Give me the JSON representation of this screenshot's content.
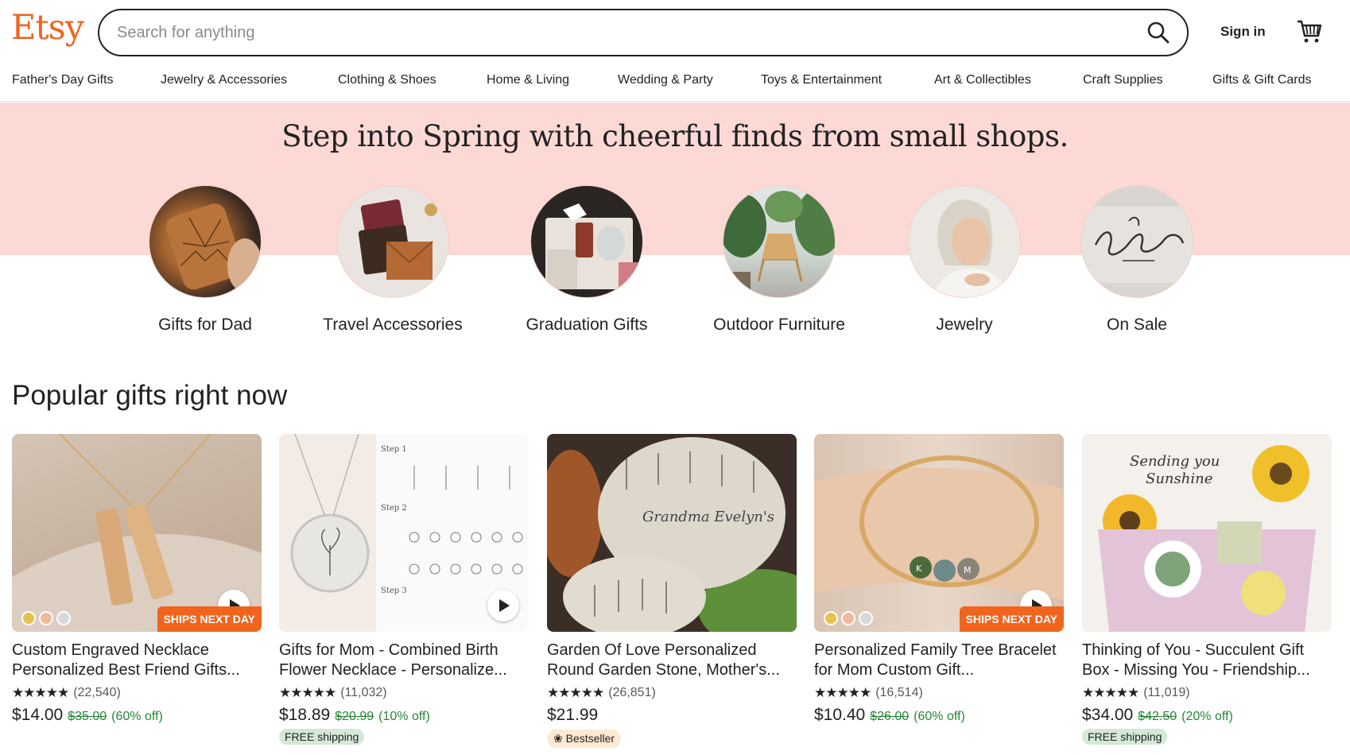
{
  "header": {
    "logo": "Etsy",
    "search_placeholder": "Search for anything",
    "sign_in": "Sign in"
  },
  "nav": [
    "Father's Day Gifts",
    "Jewelry & Accessories",
    "Clothing & Shoes",
    "Home & Living",
    "Wedding & Party",
    "Toys & Entertainment",
    "Art & Collectibles",
    "Craft Supplies",
    "Gifts & Gift Cards"
  ],
  "banner": {
    "headline": "Step into Spring with cheerful finds from small shops.",
    "categories": [
      {
        "label": "Gifts for Dad"
      },
      {
        "label": "Travel Accessories"
      },
      {
        "label": "Graduation Gifts"
      },
      {
        "label": "Outdoor Furniture"
      },
      {
        "label": "Jewelry"
      },
      {
        "label": "On Sale"
      }
    ]
  },
  "popular": {
    "title": "Popular gifts right now",
    "items": [
      {
        "title": "Custom Engraved Necklace Personalized Best Friend Gifts...",
        "stars": "★★★★★",
        "reviews": "(22,540)",
        "price": "$14.00",
        "old_price": "$35.00",
        "discount": "(60% off)",
        "ships_next_day": "SHIPS NEXT DAY"
      },
      {
        "title": "Gifts for Mom - Combined Birth Flower Necklace - Personalize...",
        "stars": "★★★★★",
        "reviews": "(11,032)",
        "price": "$18.89",
        "old_price": "$20.99",
        "discount": "(10% off)",
        "badge": "FREE shipping"
      },
      {
        "title": "Garden Of Love Personalized Round Garden Stone, Mother's...",
        "stars": "★★★★★",
        "reviews": "(26,851)",
        "price": "$21.99",
        "badge": "Bestseller"
      },
      {
        "title": "Personalized Family Tree Bracelet for Mom Custom Gift...",
        "stars": "★★★★★",
        "reviews": "(16,514)",
        "price": "$10.40",
        "old_price": "$26.00",
        "discount": "(60% off)",
        "ships_next_day": "SHIPS NEXT DAY"
      },
      {
        "title": "Thinking of You - Succulent Gift Box - Missing You - Friendship...",
        "stars": "★★★★★",
        "reviews": "(11,019)",
        "price": "$34.00",
        "old_price": "$42.50",
        "discount": "(20% off)",
        "badge": "FREE shipping"
      }
    ]
  },
  "colors": {
    "brand": "#f1641e",
    "banner_bg": "#fdd9d6",
    "discount_green": "#258635"
  }
}
